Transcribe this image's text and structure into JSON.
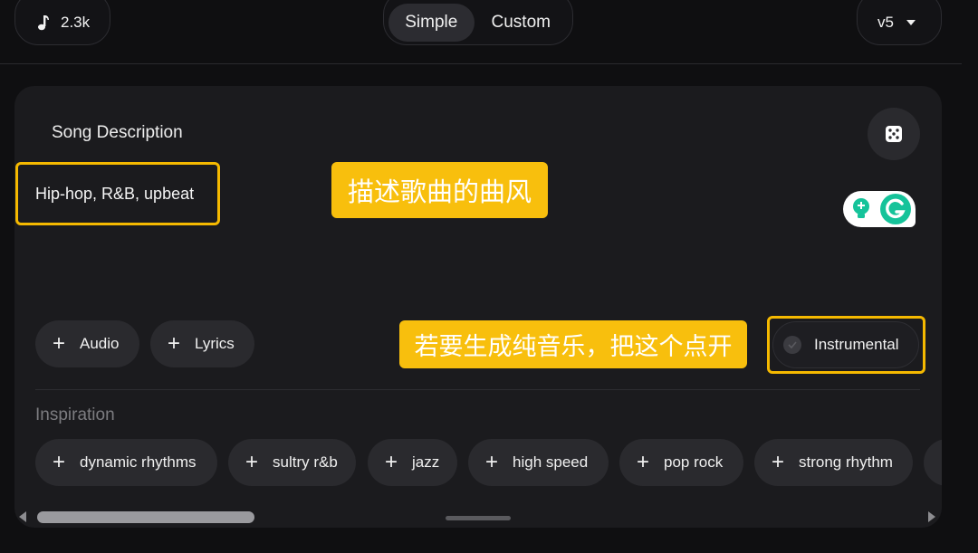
{
  "header": {
    "credits": "2.3k",
    "modes": [
      {
        "label": "Simple",
        "active": true
      },
      {
        "label": "Custom",
        "active": false
      }
    ],
    "version": "v5"
  },
  "form": {
    "song_description_label": "Song Description",
    "song_description_value": "Hip-hop, R&B, upbeat",
    "buttons": {
      "audio": "Audio",
      "lyrics": "Lyrics"
    },
    "instrumental_label": "Instrumental",
    "inspiration_label": "Inspiration",
    "inspiration_tags": [
      "dynamic rhythms",
      "sultry r&b",
      "jazz",
      "high speed",
      "pop rock",
      "strong rhythm"
    ]
  },
  "annotations": {
    "description_hint": "描述歌曲的曲风",
    "instrumental_hint": "若要生成纯音乐，把这个点开"
  },
  "icons": {
    "credits": "music-note-icon",
    "version": "chevron-down-icon",
    "random": "dice-icon",
    "add": "plus-icon",
    "assistant": "grammarly-icon"
  },
  "colors": {
    "background": "#0f0f11",
    "panel": "#1b1b1e",
    "chip": "#2a2a2e",
    "annotation": "#f8bf0d",
    "highlight_border": "#f5b900",
    "grammarly_green": "#15c39a"
  }
}
